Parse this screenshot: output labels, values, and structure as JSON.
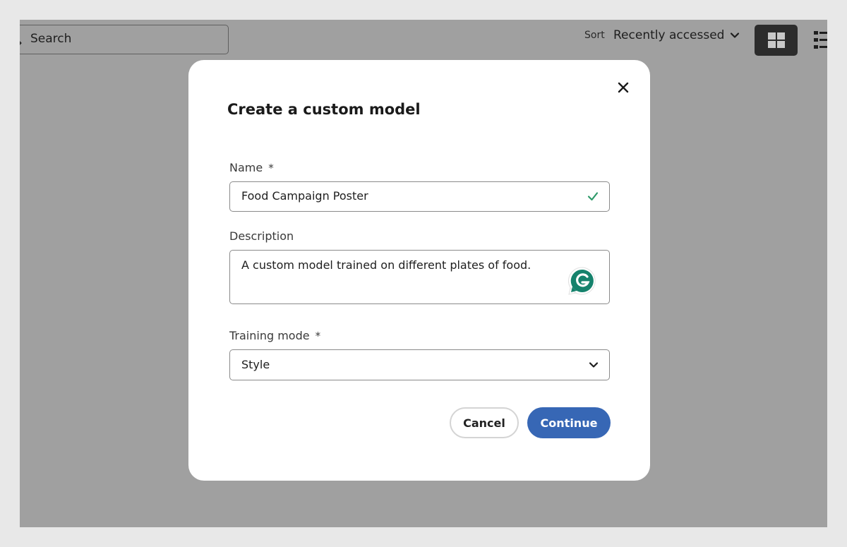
{
  "toolbar": {
    "search_placeholder": "Search",
    "sort_label": "Sort",
    "sort_value": "Recently accessed",
    "view_modes": [
      {
        "name": "grid-view",
        "active": true
      },
      {
        "name": "list-view",
        "active": false
      }
    ]
  },
  "dialog": {
    "title": "Create a custom model",
    "close_icon": "close-icon",
    "fields": {
      "name": {
        "label": "Name",
        "required_marker": "*",
        "value": "Food Campaign Poster",
        "valid": true
      },
      "description": {
        "label": "Description",
        "value": "A custom model trained on different plates of food."
      },
      "training_mode": {
        "label": "Training mode",
        "required_marker": "*",
        "value": "Style"
      }
    },
    "buttons": {
      "cancel": "Cancel",
      "continue": "Continue"
    }
  },
  "colors": {
    "primary": "#3767b5",
    "valid": "#2e9a6a",
    "grammarly": "#15826c",
    "overlay": "#a0a0a0"
  }
}
